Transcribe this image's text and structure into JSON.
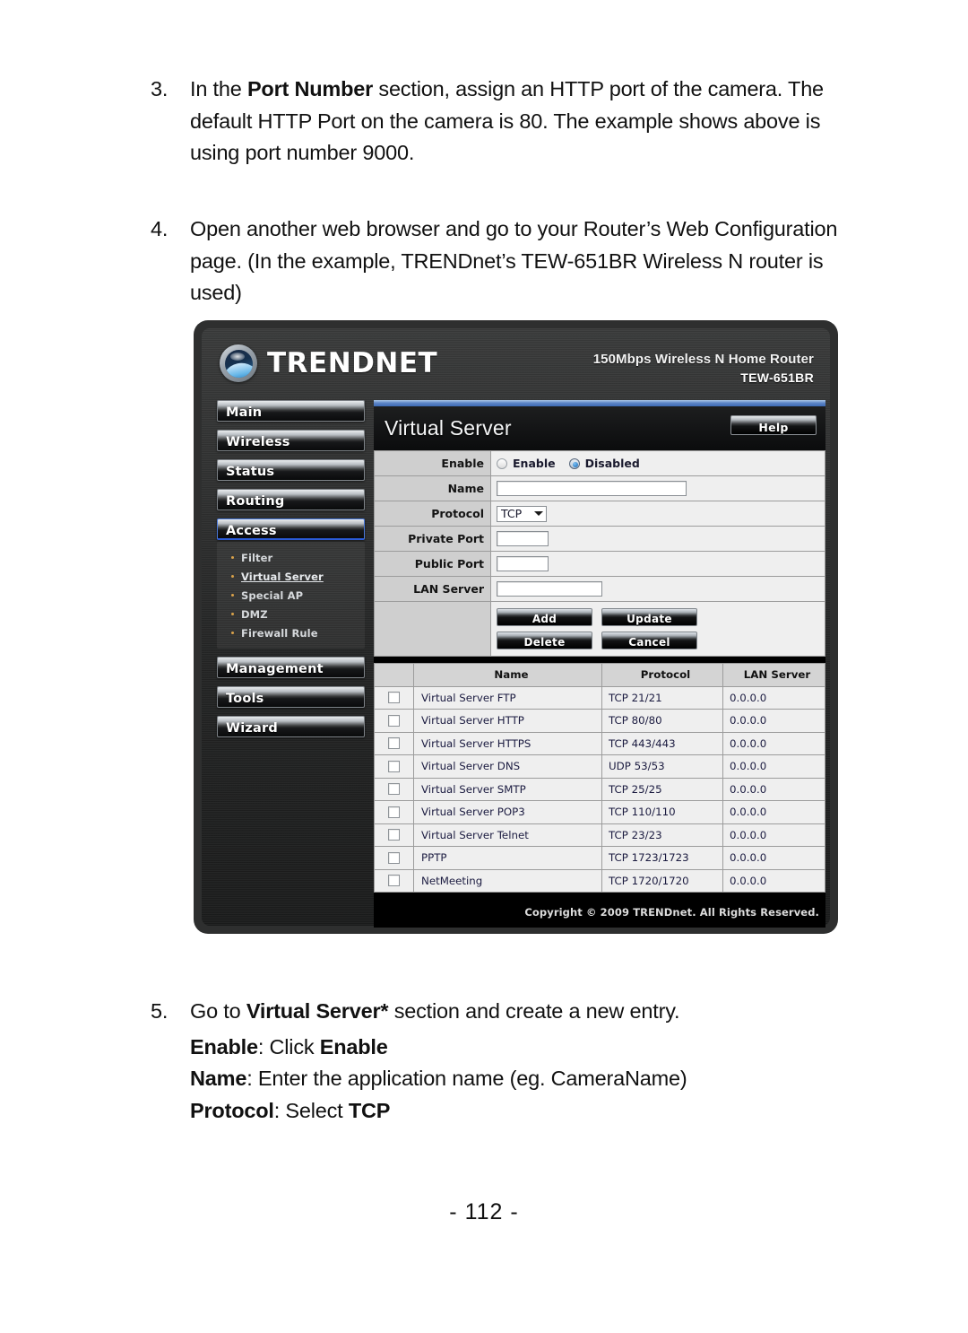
{
  "document": {
    "page_number": "- 112 -",
    "steps": [
      {
        "number": "3.",
        "segments": [
          {
            "text": "In the ",
            "bold": false
          },
          {
            "text": "Port Number",
            "bold": true
          },
          {
            "text": " section, assign an HTTP port of the camera. The default HTTP Port on the camera is 80. The example shows above is using port number 9000.",
            "bold": false
          }
        ]
      },
      {
        "number": "4.",
        "segments": [
          {
            "text": "Open another web browser and go to your Router’s Web Configuration page. (In the example, TRENDnet’s TEW-651BR Wireless N router is used)",
            "bold": false
          }
        ]
      },
      {
        "number": "5.",
        "segments": [
          {
            "text": "Go to ",
            "bold": false
          },
          {
            "text": "Virtual Server*",
            "bold": true
          },
          {
            "text": " section and create a new entry.",
            "bold": false
          }
        ],
        "sub_lines": [
          [
            {
              "text": "Enable",
              "bold": true
            },
            {
              "text": ": Click ",
              "bold": false
            },
            {
              "text": "Enable",
              "bold": true
            }
          ],
          [
            {
              "text": "Name",
              "bold": true
            },
            {
              "text": ": Enter the application name (eg. CameraName)",
              "bold": false
            }
          ],
          [
            {
              "text": "Protocol",
              "bold": true
            },
            {
              "text": ": Select ",
              "bold": false
            },
            {
              "text": "TCP",
              "bold": true
            }
          ]
        ]
      }
    ]
  },
  "router_ui": {
    "brand": "TRENDNET",
    "model_line1": "150Mbps Wireless N Home Router",
    "model_line2": "TEW-651BR",
    "copyright": "Copyright © 2009 TRENDnet. All Rights Reserved.",
    "sidebar": {
      "items": [
        {
          "label": "Main",
          "active": false
        },
        {
          "label": "Wireless",
          "active": false
        },
        {
          "label": "Status",
          "active": false
        },
        {
          "label": "Routing",
          "active": false
        },
        {
          "label": "Access",
          "active": true
        },
        {
          "label": "Management",
          "active": false
        },
        {
          "label": "Tools",
          "active": false
        },
        {
          "label": "Wizard",
          "active": false
        }
      ],
      "submenu": [
        {
          "label": "Filter",
          "selected": false
        },
        {
          "label": "Virtual Server",
          "selected": true
        },
        {
          "label": "Special AP",
          "selected": false
        },
        {
          "label": "DMZ",
          "selected": false
        },
        {
          "label": "Firewall Rule",
          "selected": false
        }
      ]
    },
    "panel": {
      "title": "Virtual Server",
      "help_label": "Help",
      "form": {
        "enable_label": "Enable",
        "enable_option": "Enable",
        "disabled_option": "Disabled",
        "enable_selected": "Disabled",
        "name_label": "Name",
        "name_value": "",
        "protocol_label": "Protocol",
        "protocol_value": "TCP",
        "private_port_label": "Private Port",
        "private_port_value": "",
        "public_port_label": "Public Port",
        "public_port_value": "",
        "lan_server_label": "LAN Server",
        "lan_server_value": "",
        "buttons": [
          {
            "label": "Add"
          },
          {
            "label": "Update"
          },
          {
            "label": "Delete"
          },
          {
            "label": "Cancel"
          }
        ]
      },
      "table": {
        "headers": [
          "",
          "Name",
          "Protocol",
          "LAN Server"
        ],
        "rows": [
          {
            "checked": false,
            "name": "Virtual Server FTP",
            "protocol": "TCP 21/21",
            "lan_server": "0.0.0.0"
          },
          {
            "checked": false,
            "name": "Virtual Server HTTP",
            "protocol": "TCP 80/80",
            "lan_server": "0.0.0.0"
          },
          {
            "checked": false,
            "name": "Virtual Server HTTPS",
            "protocol": "TCP 443/443",
            "lan_server": "0.0.0.0"
          },
          {
            "checked": false,
            "name": "Virtual Server DNS",
            "protocol": "UDP 53/53",
            "lan_server": "0.0.0.0"
          },
          {
            "checked": false,
            "name": "Virtual Server SMTP",
            "protocol": "TCP 25/25",
            "lan_server": "0.0.0.0"
          },
          {
            "checked": false,
            "name": "Virtual Server POP3",
            "protocol": "TCP 110/110",
            "lan_server": "0.0.0.0"
          },
          {
            "checked": false,
            "name": "Virtual Server Telnet",
            "protocol": "TCP 23/23",
            "lan_server": "0.0.0.0"
          },
          {
            "checked": false,
            "name": "PPTP",
            "protocol": "TCP 1723/1723",
            "lan_server": "0.0.0.0"
          },
          {
            "checked": false,
            "name": "NetMeeting",
            "protocol": "TCP 1720/1720",
            "lan_server": "0.0.0.0"
          }
        ]
      }
    }
  },
  "colors": {
    "accent_blue": "#3d69b4",
    "submenu_bullet": "#d9a24a",
    "table_header_bg": "#d4d4d4",
    "form_label_bg": "#cfcfcf",
    "page_bg": "#ffffff"
  }
}
